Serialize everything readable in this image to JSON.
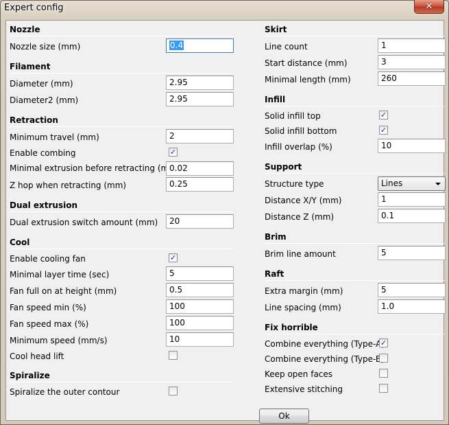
{
  "window": {
    "title": "Expert config",
    "close_glyph": "✕"
  },
  "left": {
    "nozzle": {
      "title": "Nozzle",
      "size_label": "Nozzle size (mm)",
      "size_value": "0.4"
    },
    "filament": {
      "title": "Filament",
      "diameter_label": "Diameter (mm)",
      "diameter_value": "2.95",
      "diameter2_label": "Diameter2 (mm)",
      "diameter2_value": "2.95"
    },
    "retraction": {
      "title": "Retraction",
      "min_travel_label": "Minimum travel (mm)",
      "min_travel_value": "2",
      "combing_label": "Enable combing",
      "combing_checked": true,
      "min_extrusion_label": "Minimal extrusion before retracting (mm)",
      "min_extrusion_value": "0.02",
      "zhop_label": "Z hop when retracting (mm)",
      "zhop_value": "0.25"
    },
    "dual": {
      "title": "Dual extrusion",
      "switch_label": "Dual extrusion switch amount (mm)",
      "switch_value": "20"
    },
    "cool": {
      "title": "Cool",
      "fan_label": "Enable cooling fan",
      "fan_checked": true,
      "layer_time_label": "Minimal layer time (sec)",
      "layer_time_value": "5",
      "fan_full_label": "Fan full on at height (mm)",
      "fan_full_value": "0.5",
      "fan_min_label": "Fan speed min (%)",
      "fan_min_value": "100",
      "fan_max_label": "Fan speed max (%)",
      "fan_max_value": "100",
      "min_speed_label": "Minimum speed (mm/s)",
      "min_speed_value": "10",
      "head_lift_label": "Cool head lift",
      "head_lift_checked": false
    },
    "spiralize": {
      "title": "Spiralize",
      "outer_label": "Spiralize the outer contour",
      "outer_checked": false
    }
  },
  "right": {
    "skirt": {
      "title": "Skirt",
      "line_count_label": "Line count",
      "line_count_value": "1",
      "start_distance_label": "Start distance (mm)",
      "start_distance_value": "3",
      "min_length_label": "Minimal length (mm)",
      "min_length_value": "260"
    },
    "infill": {
      "title": "Infill",
      "solid_top_label": "Solid infill top",
      "solid_top_checked": true,
      "solid_bottom_label": "Solid infill bottom",
      "solid_bottom_checked": true,
      "overlap_label": "Infill overlap (%)",
      "overlap_value": "10"
    },
    "support": {
      "title": "Support",
      "structure_label": "Structure type",
      "structure_value": "Lines",
      "distance_xy_label": "Distance X/Y (mm)",
      "distance_xy_value": "1",
      "distance_z_label": "Distance Z (mm)",
      "distance_z_value": "0.1"
    },
    "brim": {
      "title": "Brim",
      "line_amount_label": "Brim line amount",
      "line_amount_value": "5"
    },
    "raft": {
      "title": "Raft",
      "extra_margin_label": "Extra margin (mm)",
      "extra_margin_value": "5",
      "line_spacing_label": "Line spacing (mm)",
      "line_spacing_value": "1.0"
    },
    "fix": {
      "title": "Fix horrible",
      "type_a_label": "Combine everything (Type-A)",
      "type_a_checked": true,
      "type_b_label": "Combine everything (Type-B)",
      "type_b_checked": false,
      "open_faces_label": "Keep open faces",
      "open_faces_checked": false,
      "stitching_label": "Extensive stitching",
      "stitching_checked": false
    }
  },
  "footer": {
    "ok_label": "Ok"
  },
  "icons": {
    "check_glyph": "✓"
  }
}
